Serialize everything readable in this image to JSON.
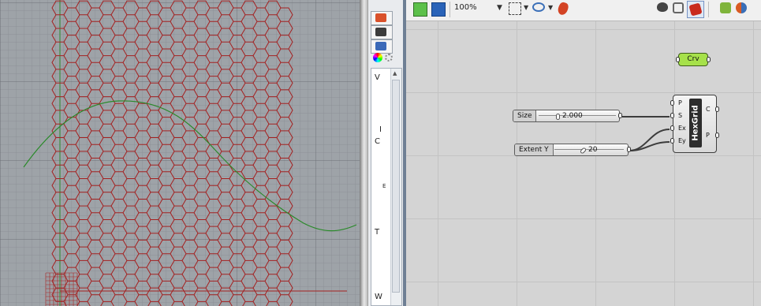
{
  "toolbar": {
    "zoom": "100%"
  },
  "rhino_panel": {
    "labels": [
      "V",
      "I",
      "C",
      "E",
      "T",
      "W"
    ]
  },
  "components": {
    "crv": {
      "label": "Crv"
    },
    "size_slider": {
      "name": "Size",
      "value": "2.000"
    },
    "extent_slider": {
      "name": "Extent Y",
      "value": "20"
    },
    "hexgrid": {
      "name": "HexGrid",
      "inputs": [
        "P",
        "S",
        "Ex",
        "Ey"
      ],
      "outputs": [
        "C",
        "P"
      ]
    }
  },
  "colors": {
    "hex_lines": "#a42121",
    "curve": "#2a8a2a",
    "crv_param": "#a6e14a",
    "viewport_bg": "#9ea3a8"
  }
}
